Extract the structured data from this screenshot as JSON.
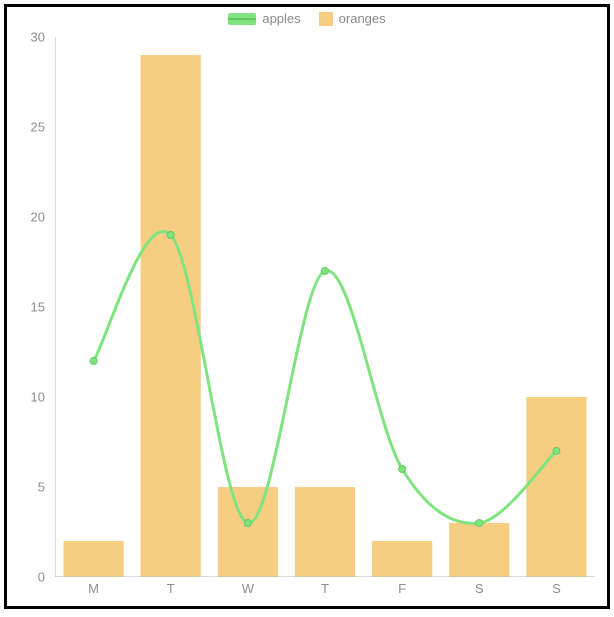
{
  "legend": {
    "apples": "apples",
    "oranges": "oranges"
  },
  "chart_data": {
    "type": "bar+line",
    "categories": [
      "M",
      "T",
      "W",
      "T",
      "F",
      "S",
      "S"
    ],
    "series": [
      {
        "name": "apples",
        "type": "line",
        "values": [
          12,
          19,
          3,
          17,
          6,
          3,
          7
        ],
        "color": "#7FE47F"
      },
      {
        "name": "oranges",
        "type": "bar",
        "values": [
          2,
          29,
          5,
          5,
          2,
          3,
          10
        ],
        "color": "#F7CD81"
      }
    ],
    "ylim": [
      0,
      30
    ],
    "yticks": [
      0,
      5,
      10,
      15,
      20,
      25,
      30
    ],
    "grid": false
  }
}
